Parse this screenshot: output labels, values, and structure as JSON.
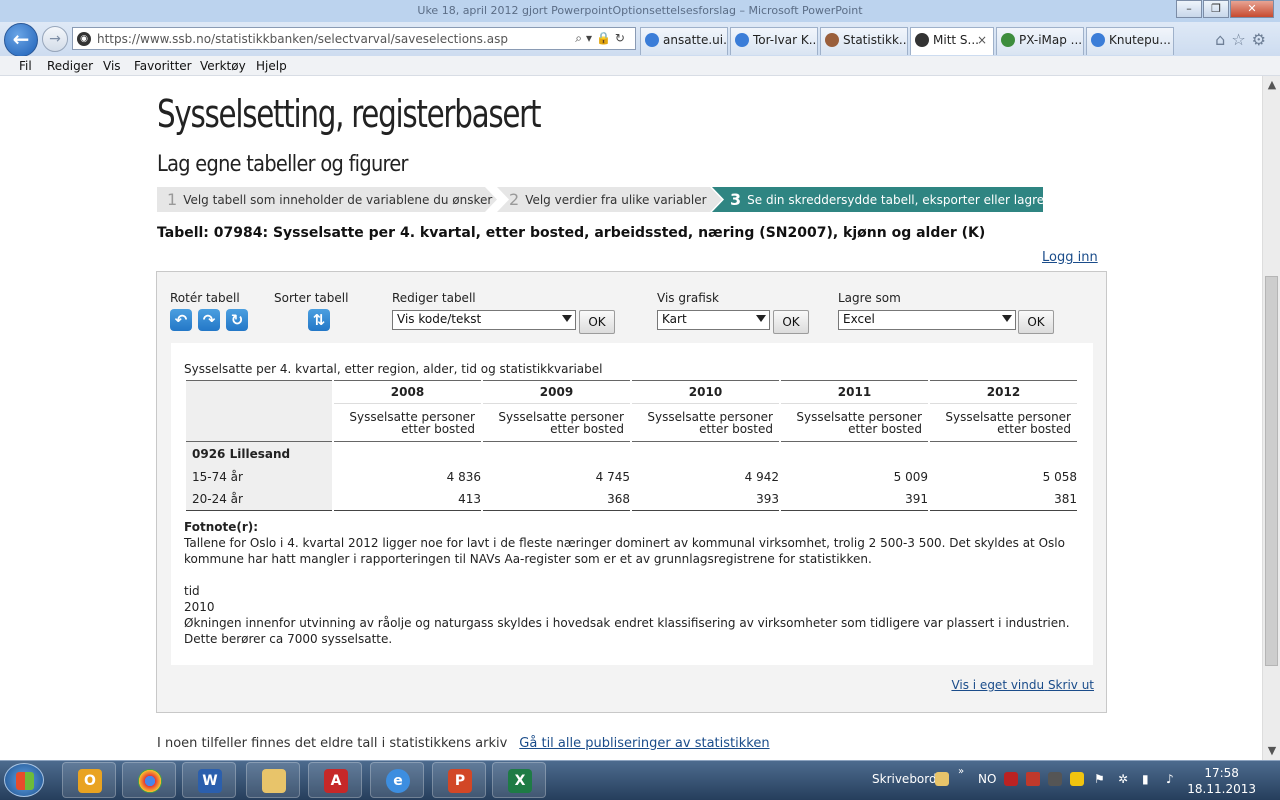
{
  "browser": {
    "window_title": "Uke 18, april 2012 gjort PowerpointOptionsettelsesforslag – Microsoft PowerPoint",
    "address": "https://www.ssb.no/statistikkbanken/selectvarval/saveselections.asp",
    "tabs": [
      {
        "label": "ansatte.ui..."
      },
      {
        "label": "Tor-Ivar K..."
      },
      {
        "label": "Statistikk..."
      },
      {
        "label": "Mitt S...",
        "close": "×"
      },
      {
        "label": "PX-iMap ..."
      },
      {
        "label": "Knutepu..."
      }
    ],
    "menu": [
      "Fil",
      "Rediger",
      "Vis",
      "Favoritter",
      "Verktøy",
      "Hjelp"
    ]
  },
  "page": {
    "title": "Sysselsetting, registerbasert",
    "subtitle": "Lag egne tabeller og figurer",
    "steps": [
      {
        "num": "1",
        "label": "Velg tabell som inneholder de variablene du ønsker"
      },
      {
        "num": "2",
        "label": "Velg verdier fra ulike variabler"
      },
      {
        "num": "3",
        "label": "Se din skreddersydde tabell, eksporter eller lagre"
      }
    ],
    "table_title": "Tabell: 07984: Sysselsatte per 4. kvartal, etter bosted, arbeidssted, næring (SN2007), kjønn og alder (K)",
    "login": "Logg inn"
  },
  "toolbar": {
    "rotate_label": "Rotér tabell",
    "sort_label": "Sorter tabell",
    "edit_label": "Rediger tabell",
    "edit_value": "Vis kode/tekst",
    "graph_label": "Vis grafisk",
    "graph_value": "Kart",
    "save_label": "Lagre som",
    "save_value": "Excel",
    "ok": "OK"
  },
  "table": {
    "caption": "Sysselsatte per 4. kvartal, etter region, alder, tid og statistikkvariabel",
    "years": [
      "2008",
      "2009",
      "2010",
      "2011",
      "2012"
    ],
    "var_header_1": "Sysselsatte personer",
    "var_header_2": "etter bosted",
    "region": "0926 Lillesand",
    "rows": [
      {
        "label": "15-74 år",
        "values": [
          "4 836",
          "4 745",
          "4 942",
          "5 009",
          "5 058"
        ]
      },
      {
        "label": "20-24 år",
        "values": [
          "413",
          "368",
          "393",
          "391",
          "381"
        ]
      }
    ],
    "footnote_title": "Fotnote(r):",
    "footnote_1": "Tallene for Oslo i 4. kvartal 2012 ligger noe for lavt i de fleste næringer dominert av kommunal virksomhet, trolig 2 500-3 500. Det skyldes at Oslo kommune har hatt mangler i rapporteringen til NAVs Aa-register som er et av grunnlagsregistrene for statistikken.",
    "footnote_var": "tid",
    "footnote_val": "2010",
    "footnote_2": "Økningen innenfor utvinning av råolje og naturgass skyldes i hovedsak endret klassifisering av virksomheter som tidligere var plassert i industrien. Dette berører ca 7000 sysselsatte.",
    "link_window": "Vis i eget vindu",
    "link_print": "Skriv ut"
  },
  "older": {
    "text": "I noen tilfeller finnes det eldre tall i statistikkens arkiv",
    "link": "Gå til alle publiseringer av statistikken"
  },
  "taskbar": {
    "desktop": "Skrivebord",
    "lang": "NO",
    "time": "17:58",
    "date": "18.11.2013"
  }
}
